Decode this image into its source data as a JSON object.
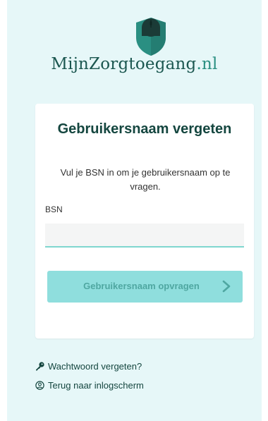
{
  "logo": {
    "brand": "MijnZorgtoegang",
    "tld": ".nl",
    "icon": "shield-mouse-icon"
  },
  "form": {
    "title": "Gebruikersnaam vergeten",
    "description": "Vul je BSN in om je gebruikersnaam op te vragen.",
    "bsn_label": "BSN",
    "bsn_value": "",
    "submit_label": "Gebruikersnaam opvragen",
    "submit_icon": "chevron-right-icon"
  },
  "links": {
    "forgot_password": {
      "label": "Wachtwoord vergeten?",
      "icon": "key-icon"
    },
    "back_to_login": {
      "label": "Terug naar inlogscherm",
      "icon": "user-circle-icon"
    }
  },
  "colors": {
    "page_background": "#e6f7f8",
    "brand_dark": "#14463f",
    "brand_accent": "#2a8f82",
    "button_background": "#8fdedd",
    "button_text": "#4fa7a1",
    "input_underline": "#7fd6cf"
  }
}
